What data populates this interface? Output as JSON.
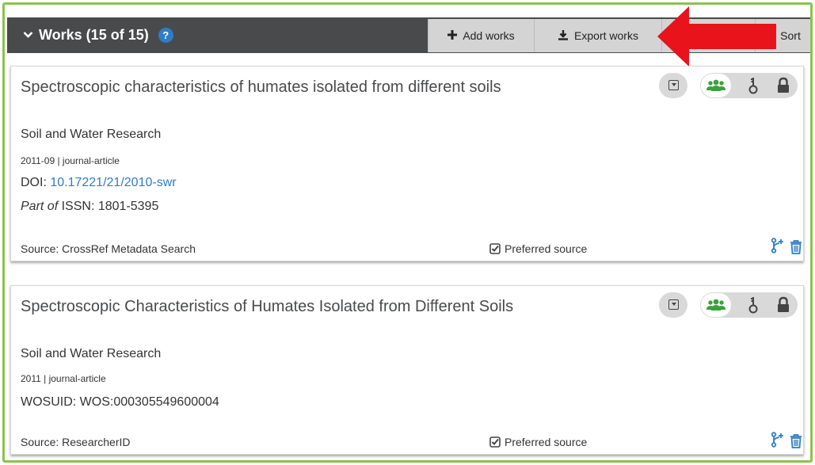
{
  "header": {
    "title": "Works (15 of 15)",
    "help_icon": "?",
    "add_label": "Add works",
    "export_label": "Export works",
    "sort_label": "Sort"
  },
  "colors": {
    "frame": "#8bc34a",
    "header_bg": "#494a4c",
    "button_bg": "#d4d4d4",
    "arrow": "#e8131b",
    "link": "#2e7dc6",
    "everyone_icon": "#3aa23a"
  },
  "works": [
    {
      "title": "Spectroscopic characteristics of humates isolated from different soils",
      "journal": "Soil and Water Research",
      "meta": "2011-09 | journal-article",
      "doi_label": "DOI:",
      "doi": "10.17221/21/2010-swr",
      "part_of": "Part of",
      "issn": "ISSN: 1801-5395",
      "source": "Source: CrossRef Metadata Search",
      "preferred": "Preferred source"
    },
    {
      "title": "Spectroscopic Characteristics of Humates Isolated from Different Soils",
      "journal": "Soil and Water Research",
      "meta": "2011 | journal-article",
      "wosuid": "WOSUID: WOS:000305549600004",
      "source": "Source: ResearcherID",
      "preferred": "Preferred source"
    }
  ],
  "icons": {
    "expand": "chevron-down-icon",
    "add": "plus-icon",
    "export": "download-icon",
    "sort": "sort-icon",
    "visibility_dropdown": "dropdown-icon",
    "everyone": "users-icon",
    "trusted": "key-icon",
    "private": "lock-icon",
    "preferred": "checkbox-icon",
    "combine": "branch-icon",
    "delete": "trash-icon"
  }
}
